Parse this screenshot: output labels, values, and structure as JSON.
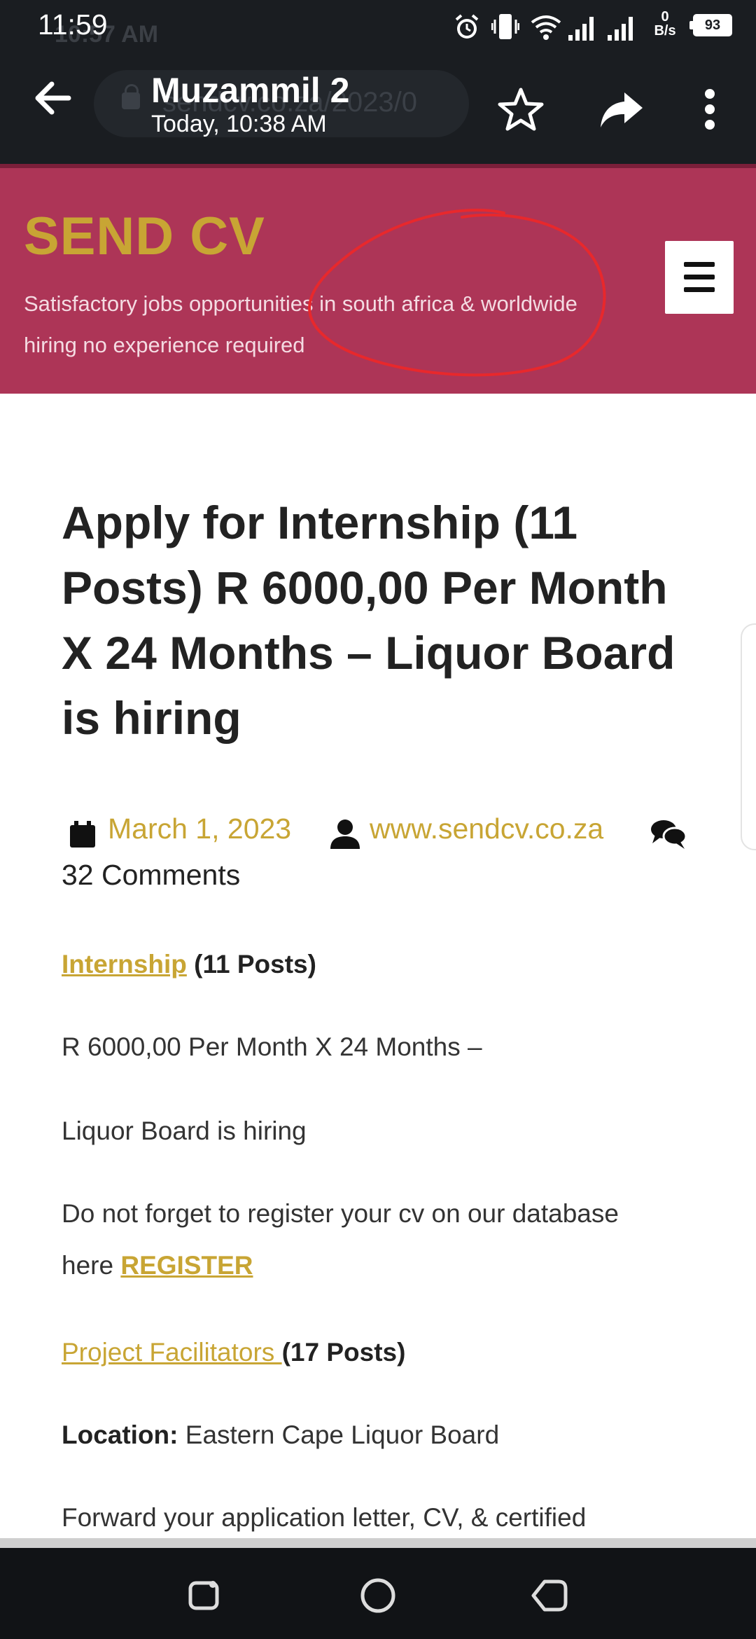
{
  "status_bar": {
    "time": "11:59",
    "ghost_time": "10:57 AM",
    "net_speed_value": "0",
    "net_speed_unit": "B/s",
    "battery": "93"
  },
  "toolbar": {
    "title": "Muzammil 2",
    "subtitle": "Today, 10:38 AM",
    "url_ghost": "sendcv.co.za/2023/0"
  },
  "site": {
    "title": "SEND CV",
    "tagline": "Satisfactory jobs opportunities in south africa & worldwide hiring no experience required"
  },
  "article": {
    "title": "Apply for Internship (11 Posts) R 6000,00 Per Month X 24 Months – Liquor Board is hiring",
    "date": "March 1, 2023",
    "author": "www.sendcv.co.za",
    "comments": "32 Comments",
    "p1_link": "Internship",
    "p1_rest": " (11 Posts)",
    "p2": "R 6000,00 Per Month X 24 Months –",
    "p3": "Liquor Board is hiring",
    "p4_line1": "Do not forget to register your cv on our database",
    "p4_line2_prefix": "here ",
    "p4_link": "REGISTER ",
    "p5_link": "Project Facilitators ",
    "p5_rest": "(17 Posts)",
    "p6_label": "Location:",
    "p6_value": " Eastern Cape Liquor Board",
    "p7": "Forward your application letter, CV, & certified"
  },
  "colors": {
    "header_bg": "#ad3557",
    "site_title": "#c8a534",
    "link": "#c8a534",
    "annotation_circle": "#e8282c"
  }
}
